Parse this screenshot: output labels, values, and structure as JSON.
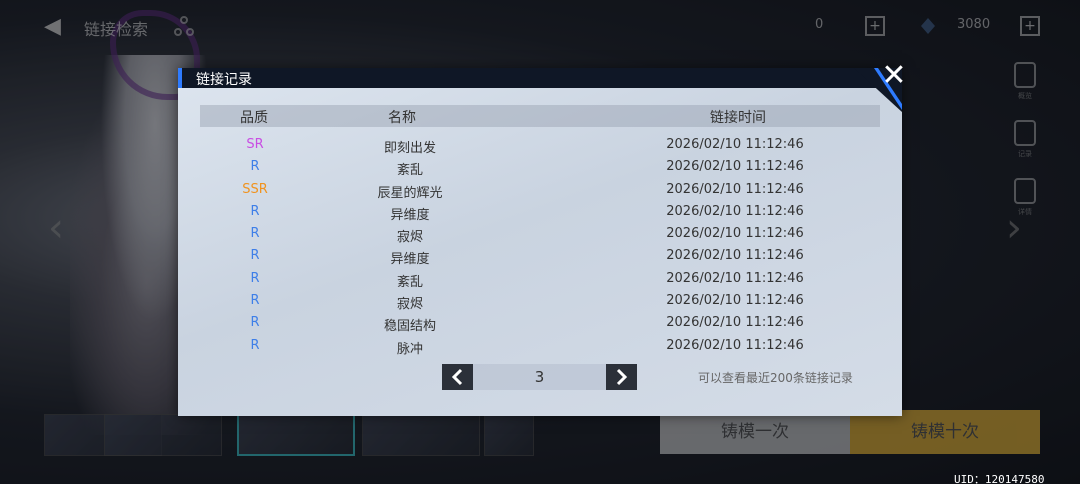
{
  "background": {
    "top_title": "链接检索",
    "resource_1_count": "0",
    "resource_2_count": "3080",
    "tools": [
      "概览",
      "记录",
      "详情"
    ],
    "forge_once": "铸模一次",
    "forge_ten": "铸模十次",
    "uid": "UID：120147580"
  },
  "modal": {
    "title": "链接记录",
    "close_icon": "close-icon",
    "columns": {
      "quality": "品质",
      "name": "名称",
      "time": "链接时间"
    },
    "rows": [
      {
        "quality": "SR",
        "name": "即刻出发",
        "time": "2026/02/10 11:12:46"
      },
      {
        "quality": "R",
        "name": "紊乱",
        "time": "2026/02/10 11:12:46"
      },
      {
        "quality": "SSR",
        "name": "辰星的辉光",
        "time": "2026/02/10 11:12:46"
      },
      {
        "quality": "R",
        "name": "异维度",
        "time": "2026/02/10 11:12:46"
      },
      {
        "quality": "R",
        "name": "寂烬",
        "time": "2026/02/10 11:12:46"
      },
      {
        "quality": "R",
        "name": "异维度",
        "time": "2026/02/10 11:12:46"
      },
      {
        "quality": "R",
        "name": "紊乱",
        "time": "2026/02/10 11:12:46"
      },
      {
        "quality": "R",
        "name": "寂烬",
        "time": "2026/02/10 11:12:46"
      },
      {
        "quality": "R",
        "name": "稳固结构",
        "time": "2026/02/10 11:12:46"
      },
      {
        "quality": "R",
        "name": "脉冲",
        "time": "2026/02/10 11:12:46"
      }
    ],
    "pager": {
      "page": "3",
      "prev_icon": "chevron-left-icon",
      "next_icon": "chevron-right-icon"
    },
    "hint": "可以查看最近200条链接记录"
  },
  "colors": {
    "SR": "#c94de3",
    "R": "#3e7fe8",
    "SSR": "#f0931f",
    "accent": "#2e7bff"
  }
}
